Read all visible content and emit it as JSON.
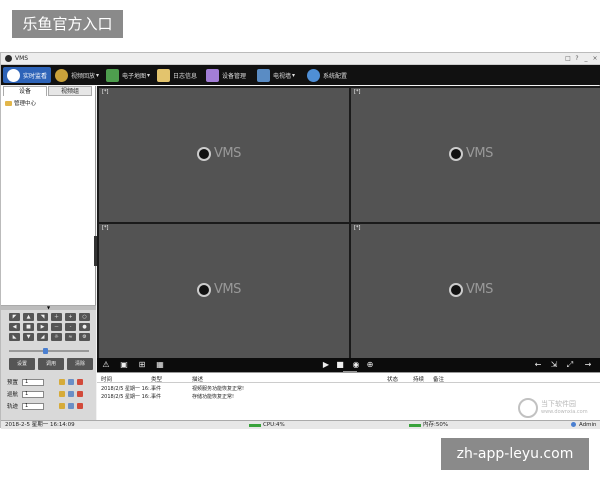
{
  "overlay": {
    "badge": "乐鱼官方入口",
    "domain": "zh-app-leyu.com"
  },
  "window": {
    "title": "VMS",
    "controls": [
      "□",
      "?",
      "_",
      "×"
    ]
  },
  "menu": [
    {
      "label": "实时监看",
      "icon": "monitor-icon",
      "color": "#4a7fd0",
      "active": true
    },
    {
      "label": "视频回放",
      "icon": "film-reel-icon",
      "color": "#c9a13a",
      "dropdown": true
    },
    {
      "label": "电子地图",
      "icon": "map-icon",
      "color": "#4e9e4e",
      "dropdown": true
    },
    {
      "label": "日志信息",
      "icon": "log-icon",
      "color": "#e3c46d"
    },
    {
      "label": "设备管理",
      "icon": "device-icon",
      "color": "#a27ed6"
    },
    {
      "label": "电视墙",
      "icon": "tv-wall-icon",
      "color": "#5a8cc4",
      "dropdown": true
    },
    {
      "label": "系统配置",
      "icon": "gear-icon",
      "color": "#4f8fd6"
    }
  ],
  "left_panel": {
    "tabs": [
      "设备",
      "视频组"
    ],
    "tree_root": "管理中心"
  },
  "ptz": {
    "rows": [
      {
        "label": "预置",
        "value": "1"
      },
      {
        "label": "巡航",
        "value": "1"
      },
      {
        "label": "轨迹",
        "value": "1"
      }
    ],
    "mid_buttons": [
      "设置",
      "调用",
      "清除"
    ]
  },
  "video_cells": [
    {
      "label": "[*]",
      "logo": "VMS"
    },
    {
      "label": "[*]",
      "logo": "VMS"
    },
    {
      "label": "[*]",
      "logo": "VMS"
    },
    {
      "label": "[*]",
      "logo": "VMS"
    }
  ],
  "events": {
    "headers": [
      "时间",
      "类型",
      "描述",
      "状态",
      "持续",
      "备注"
    ],
    "rows": [
      {
        "time": "2018/2/5 星期一 16:...",
        "type": "事件",
        "desc": "视频服务功能恢复正常!"
      },
      {
        "time": "2018/2/5 星期一 16:...",
        "type": "事件",
        "desc": "存储功能恢复正常!"
      }
    ]
  },
  "status": {
    "datetime": "2018-2-5 星期一 16:14:09",
    "cpu": "CPU:4%",
    "memory": "内存:50%",
    "user": "Admin"
  },
  "watermark": {
    "line1": "当下软件园",
    "line2": "www.downxia.com"
  }
}
